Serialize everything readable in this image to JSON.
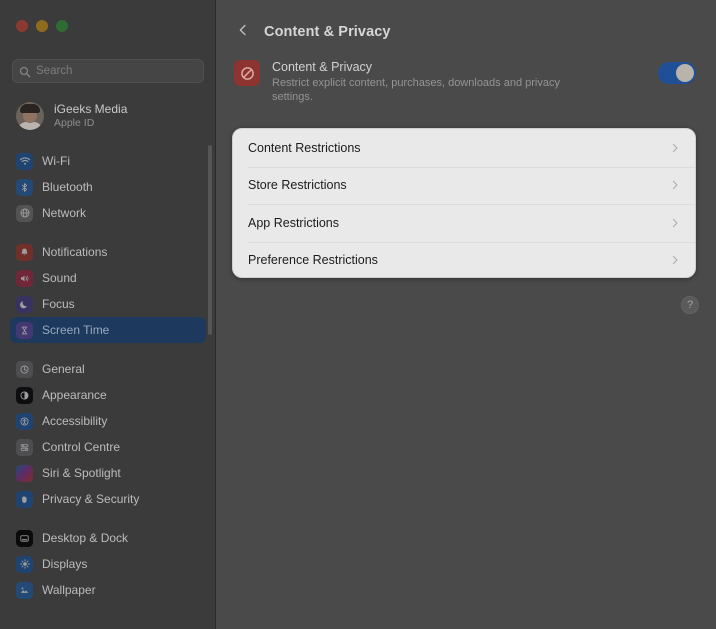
{
  "window": {
    "traffic_lights": [
      "close",
      "minimize",
      "zoom"
    ]
  },
  "sidebar": {
    "search": {
      "placeholder": "Search",
      "value": "",
      "icon": "search-icon"
    },
    "account": {
      "name": "iGeeks Media",
      "subtitle": "Apple ID",
      "avatar": "user-avatar"
    },
    "groups": [
      {
        "items": [
          {
            "label": "Wi-Fi",
            "icon": "wifi-icon"
          },
          {
            "label": "Bluetooth",
            "icon": "bluetooth-icon"
          },
          {
            "label": "Network",
            "icon": "network-globe-icon"
          }
        ]
      },
      {
        "items": [
          {
            "label": "Notifications",
            "icon": "notifications-bell-icon"
          },
          {
            "label": "Sound",
            "icon": "sound-speaker-icon"
          },
          {
            "label": "Focus",
            "icon": "focus-moon-icon"
          },
          {
            "label": "Screen Time",
            "icon": "screen-time-hourglass-icon",
            "selected": true
          }
        ]
      },
      {
        "items": [
          {
            "label": "General",
            "icon": "general-gear-icon"
          },
          {
            "label": "Appearance",
            "icon": "appearance-contrast-icon"
          },
          {
            "label": "Accessibility",
            "icon": "accessibility-person-icon"
          },
          {
            "label": "Control Centre",
            "icon": "control-centre-icon"
          },
          {
            "label": "Siri & Spotlight",
            "icon": "siri-icon"
          },
          {
            "label": "Privacy & Security",
            "icon": "privacy-hand-icon"
          }
        ]
      },
      {
        "items": [
          {
            "label": "Desktop & Dock",
            "icon": "desktop-dock-icon"
          },
          {
            "label": "Displays",
            "icon": "displays-brightness-icon"
          },
          {
            "label": "Wallpaper",
            "icon": "wallpaper-icon"
          }
        ]
      }
    ]
  },
  "main": {
    "back_icon": "chevron-left-icon",
    "title": "Content & Privacy",
    "feature": {
      "icon": "prohibited-icon",
      "title": "Content & Privacy",
      "description": "Restrict explicit content, purchases, downloads and privacy settings.",
      "toggle_state": "on"
    },
    "restrictions_card": {
      "rows": [
        {
          "label": "Content Restrictions",
          "chevron": "chevron-right-icon"
        },
        {
          "label": "Store Restrictions",
          "chevron": "chevron-right-icon"
        },
        {
          "label": "App Restrictions",
          "chevron": "chevron-right-icon"
        },
        {
          "label": "Preference Restrictions",
          "chevron": "chevron-right-icon"
        }
      ]
    },
    "help_button": {
      "label": "?",
      "icon": "help-question-icon"
    }
  },
  "colors": {
    "accent_blue": "#1f4f96",
    "selection_blue": "#1d3a5e",
    "card_background": "#e9e9e9",
    "sidebar_background": "#3b3b3b",
    "main_background": "#4a4a4a",
    "feature_icon_red": "#8e3430"
  }
}
